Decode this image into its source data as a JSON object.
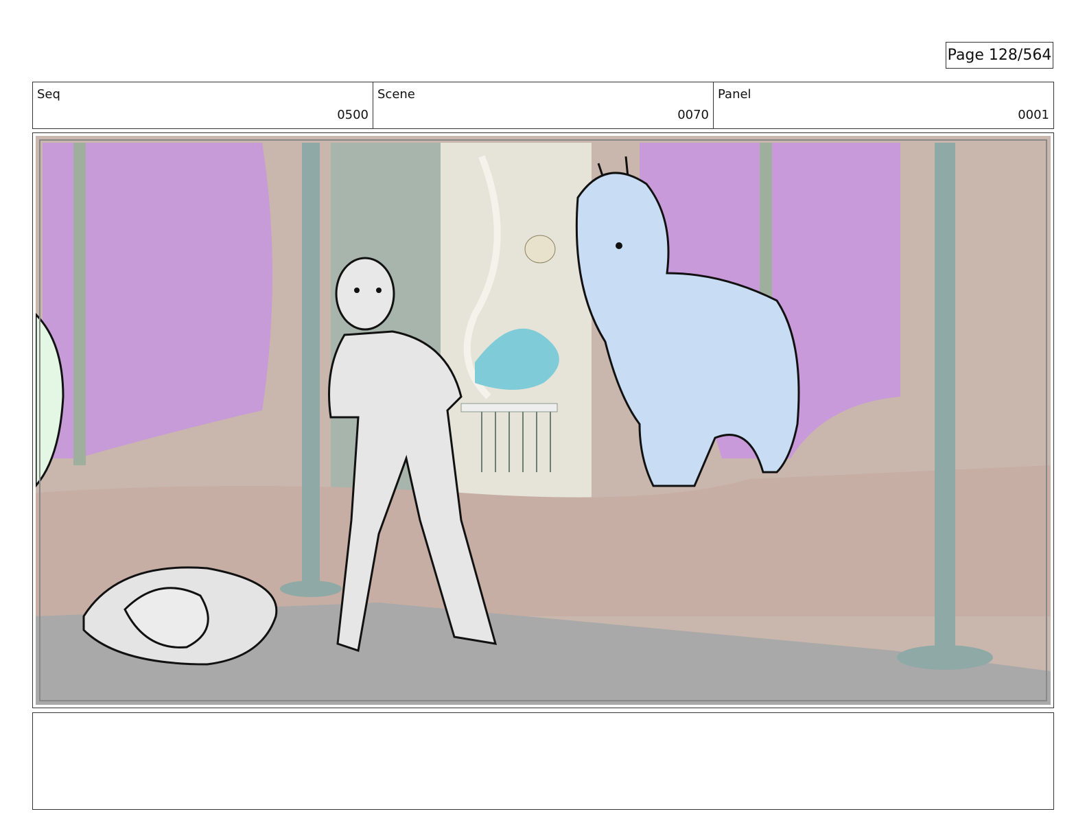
{
  "page": {
    "label": "Page 128/564"
  },
  "header": {
    "seq": {
      "label": "Seq",
      "value": "0500"
    },
    "scene": {
      "label": "Scene",
      "value": "0070"
    },
    "panel": {
      "label": "Panel",
      "value": "0001"
    }
  },
  "notes": {
    "text": ""
  }
}
